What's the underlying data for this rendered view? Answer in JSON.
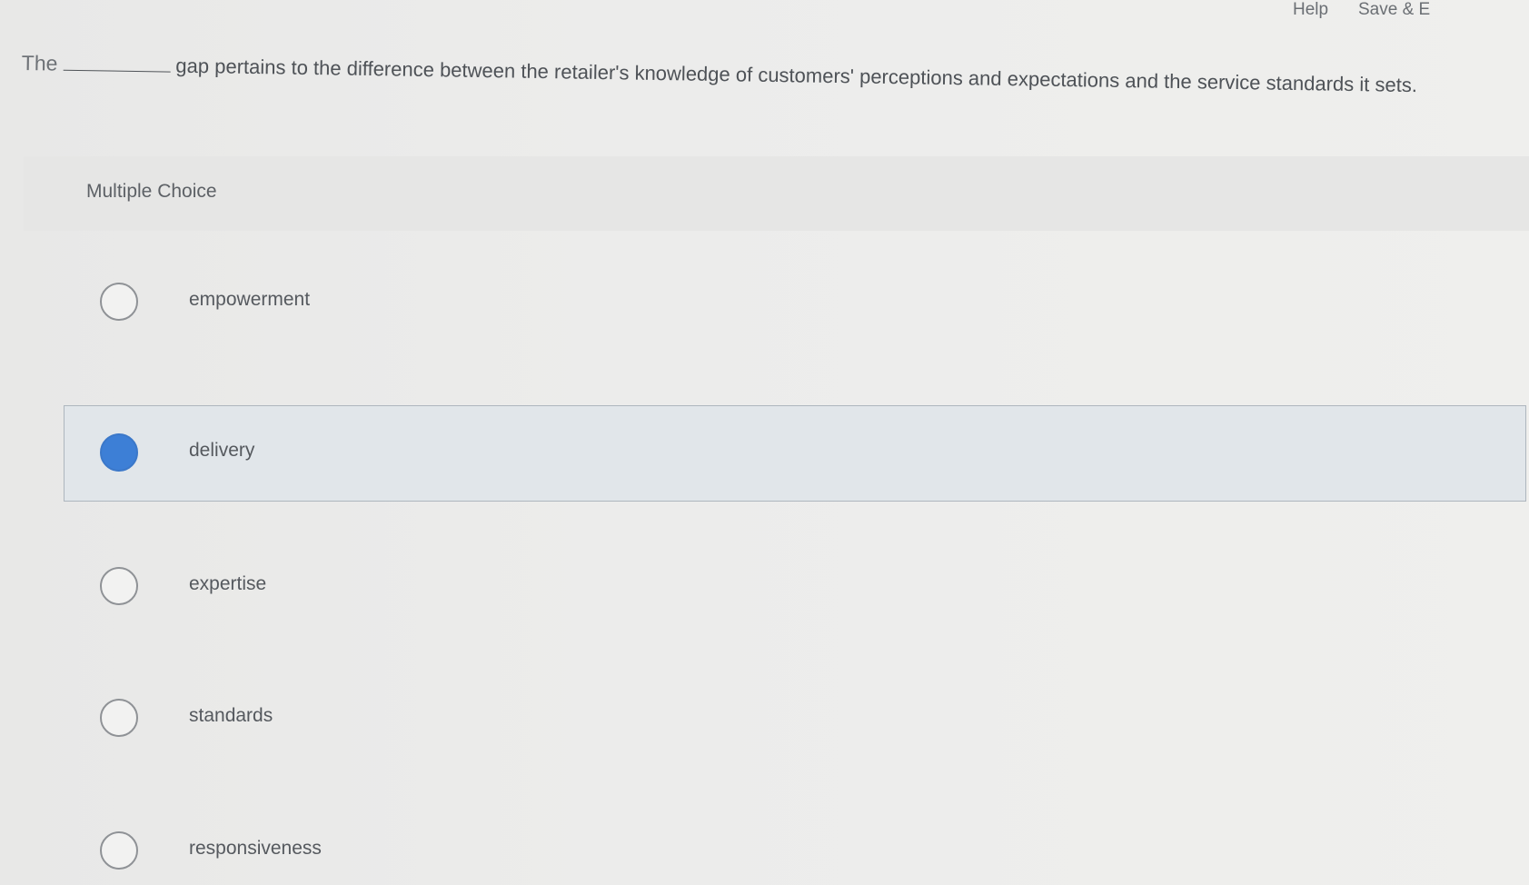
{
  "header": {
    "help_label": "Help",
    "save_label": "Save & E"
  },
  "question": {
    "lead": "The",
    "rest": "gap pertains to the difference between the retailer's knowledge of customers' perceptions and expectations and the service standards it sets."
  },
  "multiple_choice": {
    "heading": "Multiple Choice",
    "options": [
      {
        "label": "empowerment",
        "selected": false
      },
      {
        "label": "delivery",
        "selected": true
      },
      {
        "label": "expertise",
        "selected": false
      },
      {
        "label": "standards",
        "selected": false
      },
      {
        "label": "responsiveness",
        "selected": false
      }
    ]
  },
  "colors": {
    "selected_radio": "#3d7fd6",
    "selected_background": "#e1e6ea"
  }
}
